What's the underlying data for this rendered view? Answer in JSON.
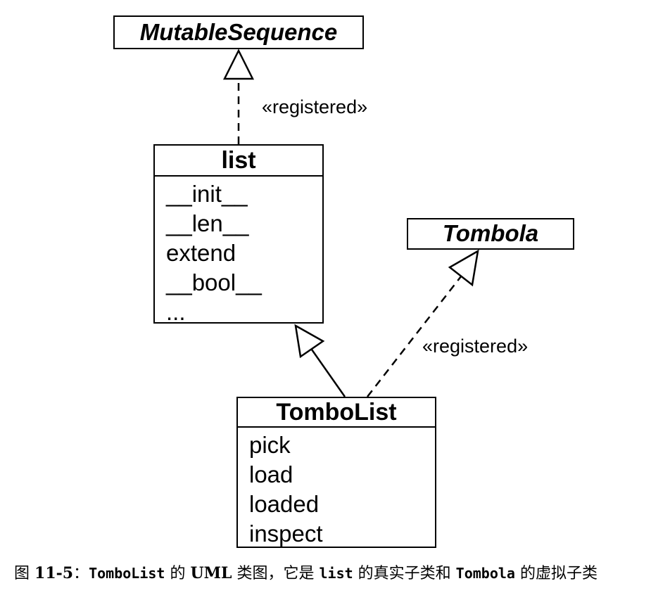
{
  "classes": {
    "mutable_sequence": {
      "name": "MutableSequence",
      "abstract": true
    },
    "list": {
      "name": "list",
      "methods": [
        "__init__",
        "__len__",
        "extend",
        "__bool__",
        "..."
      ]
    },
    "tombola": {
      "name": "Tombola",
      "abstract": true
    },
    "tombolist": {
      "name": "TomboList",
      "methods": [
        "pick",
        "load",
        "loaded",
        "inspect"
      ]
    }
  },
  "relations": [
    {
      "from": "list",
      "to": "MutableSequence",
      "kind": "virtual-subclass",
      "label": "«registered»"
    },
    {
      "from": "TomboList",
      "to": "list",
      "kind": "subclass"
    },
    {
      "from": "TomboList",
      "to": "Tombola",
      "kind": "virtual-subclass",
      "label": "«registered»"
    }
  ],
  "caption": {
    "fig": "图",
    "number": "11-5",
    "sep": "：",
    "code1": "TomboList",
    "t1": " 的 ",
    "uml": "UML",
    "t2": " 类图，它是 ",
    "code2": "list",
    "t3": " 的真实子类和 ",
    "code3": "Tombola",
    "t4": " 的虚拟子类"
  }
}
